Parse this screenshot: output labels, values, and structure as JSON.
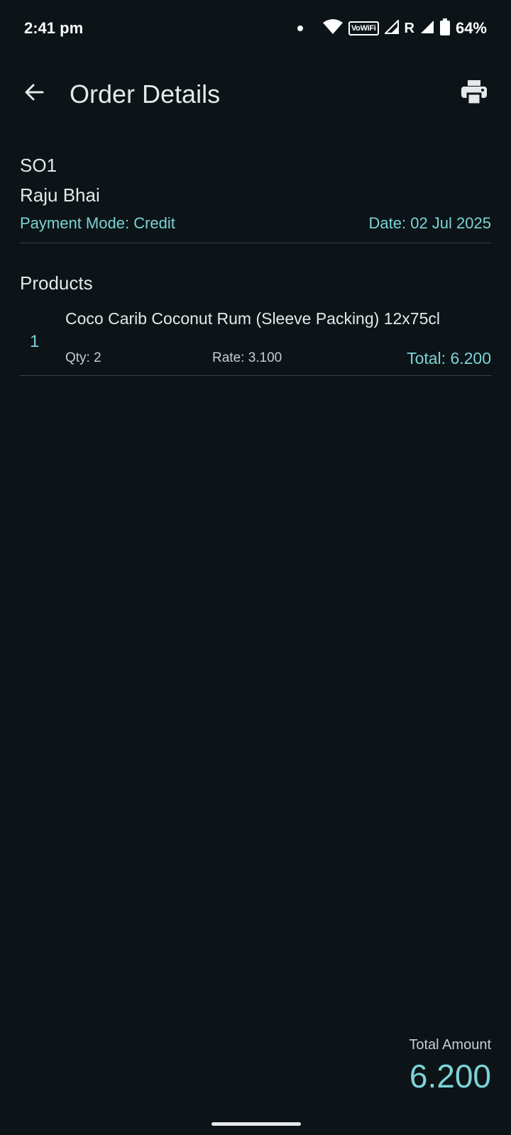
{
  "status_bar": {
    "time": "2:41 pm",
    "vowifi": "VoWiFi",
    "roaming": "R",
    "battery": "64%"
  },
  "app_bar": {
    "title": "Order Details",
    "back_icon": "arrow-back-icon",
    "print_icon": "printer-icon"
  },
  "order": {
    "id": "SO1",
    "customer": "Raju Bhai",
    "payment_mode": "Payment Mode: Credit",
    "date": "Date: 02 Jul 2025"
  },
  "products": {
    "section_title": "Products",
    "items": [
      {
        "index": "1",
        "name": "Coco Carib Coconut Rum (Sleeve Packing) 12x75cl",
        "qty": "Qty: 2",
        "rate": "Rate: 3.100",
        "total": "Total: 6.200"
      }
    ]
  },
  "summary": {
    "label": "Total Amount",
    "value": "6.200"
  },
  "colors": {
    "background": "#0c1417",
    "accent": "#7dd3d8",
    "text": "#e6e8ea"
  }
}
